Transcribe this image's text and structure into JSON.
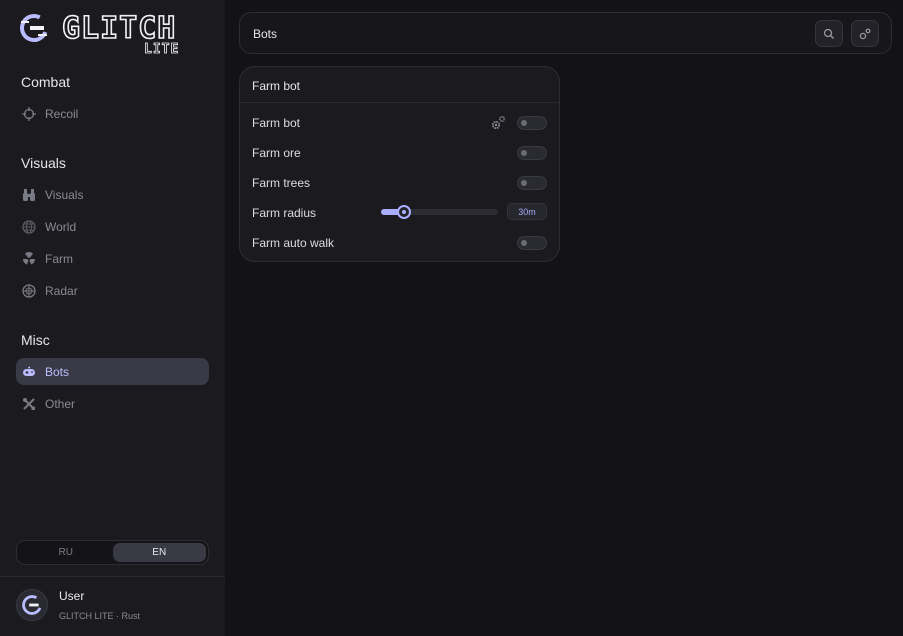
{
  "brand": {
    "name": "GLITCH",
    "edition": "LITE"
  },
  "sidebar": {
    "sections": [
      {
        "title": "Combat",
        "items": [
          {
            "label": "Recoil",
            "icon": "crosshair-icon"
          }
        ]
      },
      {
        "title": "Visuals",
        "items": [
          {
            "label": "Visuals",
            "icon": "binoculars-icon"
          },
          {
            "label": "World",
            "icon": "globe-icon"
          },
          {
            "label": "Farm",
            "icon": "radiation-icon"
          },
          {
            "label": "Radar",
            "icon": "radar-icon"
          }
        ]
      },
      {
        "title": "Misc",
        "items": [
          {
            "label": "Bots",
            "icon": "gamepad-icon",
            "active": true
          },
          {
            "label": "Other",
            "icon": "tools-icon"
          }
        ]
      }
    ],
    "language": {
      "options": [
        "RU",
        "EN"
      ],
      "selected": "EN"
    },
    "user": {
      "name": "User",
      "subtitle": "GLITCH LITE · Rust"
    }
  },
  "topbar": {
    "title": "Bots",
    "search_icon": "search-icon",
    "settings_icon": "settings-icon"
  },
  "card": {
    "title": "Farm bot",
    "rows": [
      {
        "label": "Farm bot",
        "type": "toggle",
        "enabled": false,
        "has_settings": true
      },
      {
        "label": "Farm ore",
        "type": "toggle",
        "enabled": false
      },
      {
        "label": "Farm trees",
        "type": "toggle",
        "enabled": false
      },
      {
        "label": "Farm radius",
        "type": "slider",
        "value": "30m",
        "fraction": 0.2
      },
      {
        "label": "Farm auto walk",
        "type": "toggle",
        "enabled": false
      }
    ]
  },
  "colors": {
    "accent": "#a9aefc",
    "background": "#131316",
    "sidebar": "#1b1b1f",
    "active_nav": "#3a3a47"
  }
}
